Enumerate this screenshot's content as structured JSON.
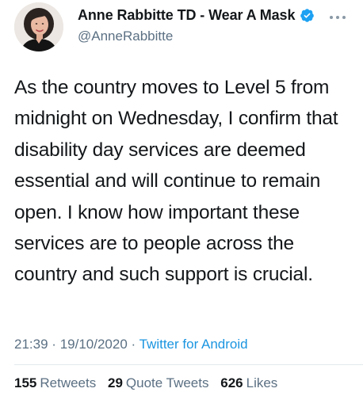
{
  "author": {
    "display_name": "Anne Rabbitte TD - Wear A Mask",
    "handle": "@AnneRabbitte",
    "verified_icon": "verified-badge-icon",
    "avatar": "profile-photo"
  },
  "tweet": {
    "text": "As the country moves to Level 5 from midnight on Wednesday, I confirm that disability day services are deemed essential and will continue to remain open. I know how important these services are to people across the country and such support is crucial.",
    "time": "21:39",
    "date": "19/10/2020",
    "separator": "·",
    "source": "Twitter for Android"
  },
  "stats": {
    "retweets_count": "155",
    "retweets_label": "Retweets",
    "quote_tweets_count": "29",
    "quote_tweets_label": "Quote Tweets",
    "likes_count": "626",
    "likes_label": "Likes"
  },
  "colors": {
    "text_primary": "#14171a",
    "text_secondary": "#5b7083",
    "link": "#1b95e0",
    "verified": "#1da1f2"
  }
}
